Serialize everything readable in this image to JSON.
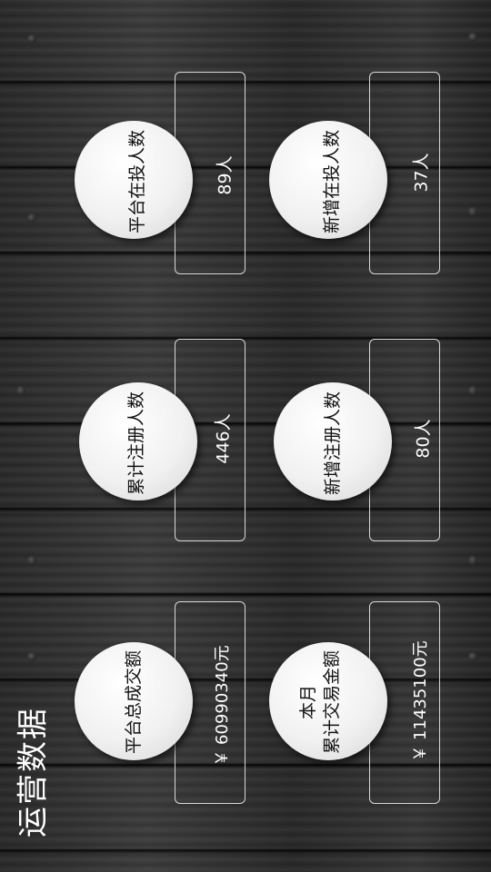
{
  "title": "运营数据",
  "cards": [
    {
      "label": "平台在投人数",
      "value": "89人"
    },
    {
      "label": "新增在投人数",
      "value": "37人"
    },
    {
      "label": "累计注册人数",
      "value": "446人"
    },
    {
      "label": "新增注册人数",
      "value": "80人"
    },
    {
      "label": "平台总成交额",
      "value": "￥ 60990340元"
    },
    {
      "label_line1": "本月",
      "label_line2": "累计交易金额",
      "value": "￥ 11435100元"
    }
  ]
}
